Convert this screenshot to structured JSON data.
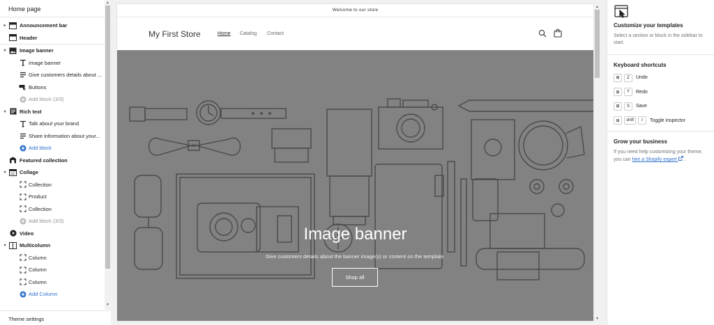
{
  "sidebar": {
    "title": "Home page",
    "tree": [
      {
        "kind": "sec",
        "caret": "▸",
        "icon": "announcement-bar-icon",
        "label": "Announcement bar"
      },
      {
        "kind": "sec",
        "caret": "",
        "icon": "header-icon",
        "label": "Header"
      },
      {
        "kind": "sep"
      },
      {
        "kind": "sec",
        "caret": "▾",
        "icon": "image-icon",
        "label": "Image banner"
      },
      {
        "kind": "child",
        "icon": "text-icon",
        "label": "Image banner"
      },
      {
        "kind": "child",
        "icon": "paragraph-icon",
        "label": "Give customers details about ..."
      },
      {
        "kind": "child",
        "icon": "buttons-icon",
        "label": "Buttons"
      },
      {
        "kind": "child",
        "icon": "add-circle-icon",
        "label": "Add block (3/3)",
        "state": "disabled"
      },
      {
        "kind": "sec",
        "caret": "▾",
        "icon": "rich-text-icon",
        "label": "Rich text"
      },
      {
        "kind": "child",
        "icon": "text-icon",
        "label": "Talk about your brand"
      },
      {
        "kind": "child",
        "icon": "paragraph-icon",
        "label": "Share information about your..."
      },
      {
        "kind": "child",
        "icon": "add-circle-icon",
        "label": "Add block",
        "state": "add"
      },
      {
        "kind": "sec",
        "caret": "",
        "icon": "featured-collection-icon",
        "label": "Featured collection"
      },
      {
        "kind": "sec",
        "caret": "▾",
        "icon": "collage-icon",
        "label": "Collage"
      },
      {
        "kind": "child",
        "icon": "block-frame-icon",
        "label": "Collection"
      },
      {
        "kind": "child",
        "icon": "block-frame-icon",
        "label": "Product"
      },
      {
        "kind": "child",
        "icon": "block-frame-icon",
        "label": "Collection"
      },
      {
        "kind": "child",
        "icon": "add-circle-icon",
        "label": "Add block (3/3)",
        "state": "disabled"
      },
      {
        "kind": "sec",
        "caret": "",
        "icon": "video-icon",
        "label": "Video"
      },
      {
        "kind": "sec",
        "caret": "▾",
        "icon": "multicolumn-icon",
        "label": "Multicolumn"
      },
      {
        "kind": "child",
        "icon": "block-frame-icon",
        "label": "Column"
      },
      {
        "kind": "child",
        "icon": "block-frame-icon",
        "label": "Column"
      },
      {
        "kind": "child",
        "icon": "block-frame-icon",
        "label": "Column"
      },
      {
        "kind": "child",
        "icon": "add-circle-icon",
        "label": "Add Column",
        "state": "add"
      }
    ],
    "footer_label": "Theme settings"
  },
  "preview": {
    "announcement": "Welcome to our store",
    "store_name": "My First Store",
    "nav": [
      "Home",
      "Catalog",
      "Contact"
    ],
    "active_nav": "Home",
    "banner": {
      "title": "Image banner",
      "subtitle": "Give customers details about the banner image(s) or content on the template.",
      "button": "Shop all"
    }
  },
  "inspector": {
    "customize_title": "Customize your templates",
    "customize_text": "Select a section or block in the sidebar to start.",
    "shortcuts_title": "Keyboard shortcuts",
    "shortcuts": [
      {
        "keys": [
          "⊞",
          "Z"
        ],
        "label": "Undo"
      },
      {
        "keys": [
          "⊞",
          "Y"
        ],
        "label": "Redo"
      },
      {
        "keys": [
          "⊞",
          "S"
        ],
        "label": "Save"
      },
      {
        "keys": [
          "⊞",
          "shift",
          "I"
        ],
        "label": "Toggle inspector"
      }
    ],
    "grow_title": "Grow your business",
    "grow_text": "If you need help customizing your theme, you can",
    "grow_link": "hire a Shopify expert",
    "grow_link_icon": "external-link-icon",
    "grow_tail": "."
  },
  "colors": {
    "accent": "#2c6ecb",
    "banner_overlay": "#828282",
    "text": "#202223"
  }
}
